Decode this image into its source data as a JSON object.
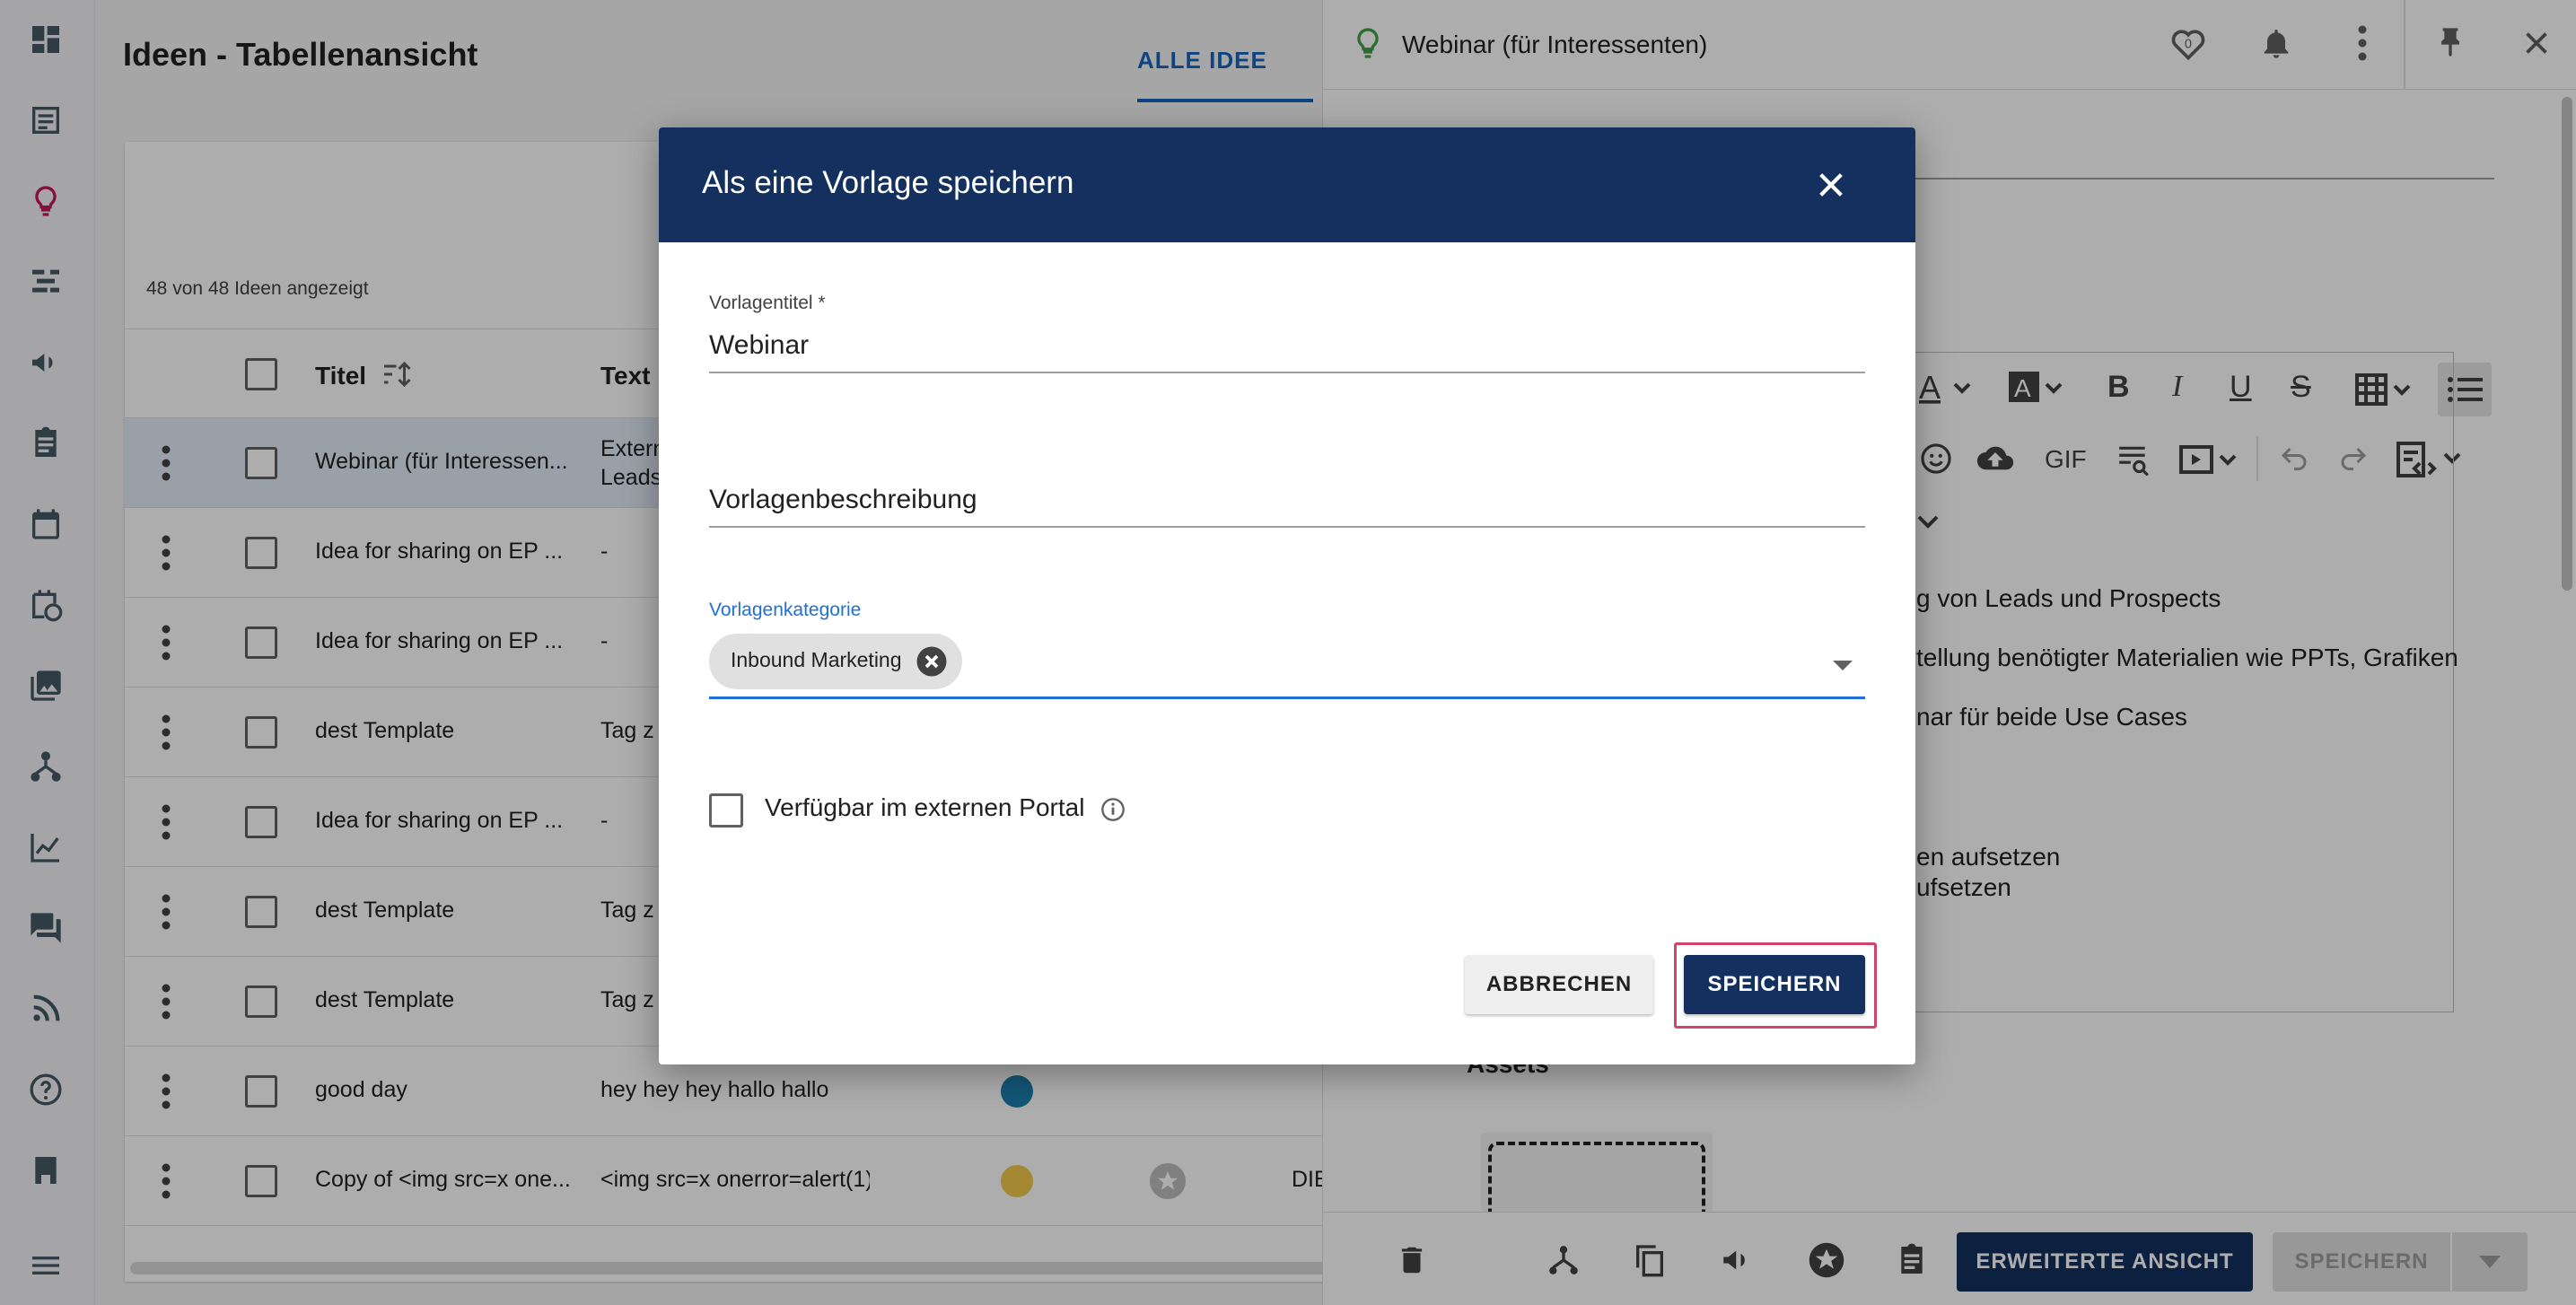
{
  "main": {
    "page_title": "Ideen - Tabellenansicht",
    "tab_all": "ALLE IDEE",
    "count_text": "48 von 48 Ideen angezeigt",
    "columns": {
      "title": "Titel",
      "text": "Text"
    },
    "rows": [
      {
        "title": "Webinar (für Interessen...",
        "text": "Extern\nLeads",
        "selected": true
      },
      {
        "title": "Idea for sharing on EP ...",
        "text": "-"
      },
      {
        "title": "Idea for sharing on EP ...",
        "text": "-"
      },
      {
        "title": "dest Template",
        "text": "Tag z"
      },
      {
        "title": "Idea for sharing on EP ...",
        "text": "-"
      },
      {
        "title": "dest Template",
        "text": "Tag z"
      },
      {
        "title": "dest Template",
        "text": "Tag z"
      },
      {
        "title": "good day",
        "text": "hey hey hey hallo   hallo",
        "dot": "#1b7fae"
      },
      {
        "title": "Copy of <img src=x one...",
        "text": "<img src=x onerror=alert(1)>",
        "dot": "#f2c94c",
        "extra": "DIE"
      }
    ]
  },
  "right_panel": {
    "title": "Webinar (für Interessenten)",
    "badge_count": "0",
    "editor_lines": [
      "g von Leads und Prospects",
      "tellung benötigter Materialien wie PPTs, Grafiken",
      "nar für beide Use Cases",
      "en aufsetzen",
      "ufsetzen"
    ],
    "gif_label": "GIF",
    "assets_label": "Assets",
    "btn_extended": "ERWEITERTE ANSICHT",
    "btn_save": "SPEICHERN"
  },
  "dialog": {
    "title": "Als eine Vorlage speichern",
    "template_title_label": "Vorlagentitel *",
    "template_title_value": "Webinar",
    "description_label": "Vorlagenbeschreibung",
    "category_label": "Vorlagenkategorie",
    "category_chip": "Inbound Marketing",
    "portal_checkbox_label": "Verfügbar im externen Portal",
    "btn_cancel": "ABBRECHEN",
    "btn_save": "SPEICHERN"
  },
  "colors": {
    "primary_dark": "#13305f",
    "accent_blue": "#1e6fd9",
    "highlight": "#d0456a"
  }
}
